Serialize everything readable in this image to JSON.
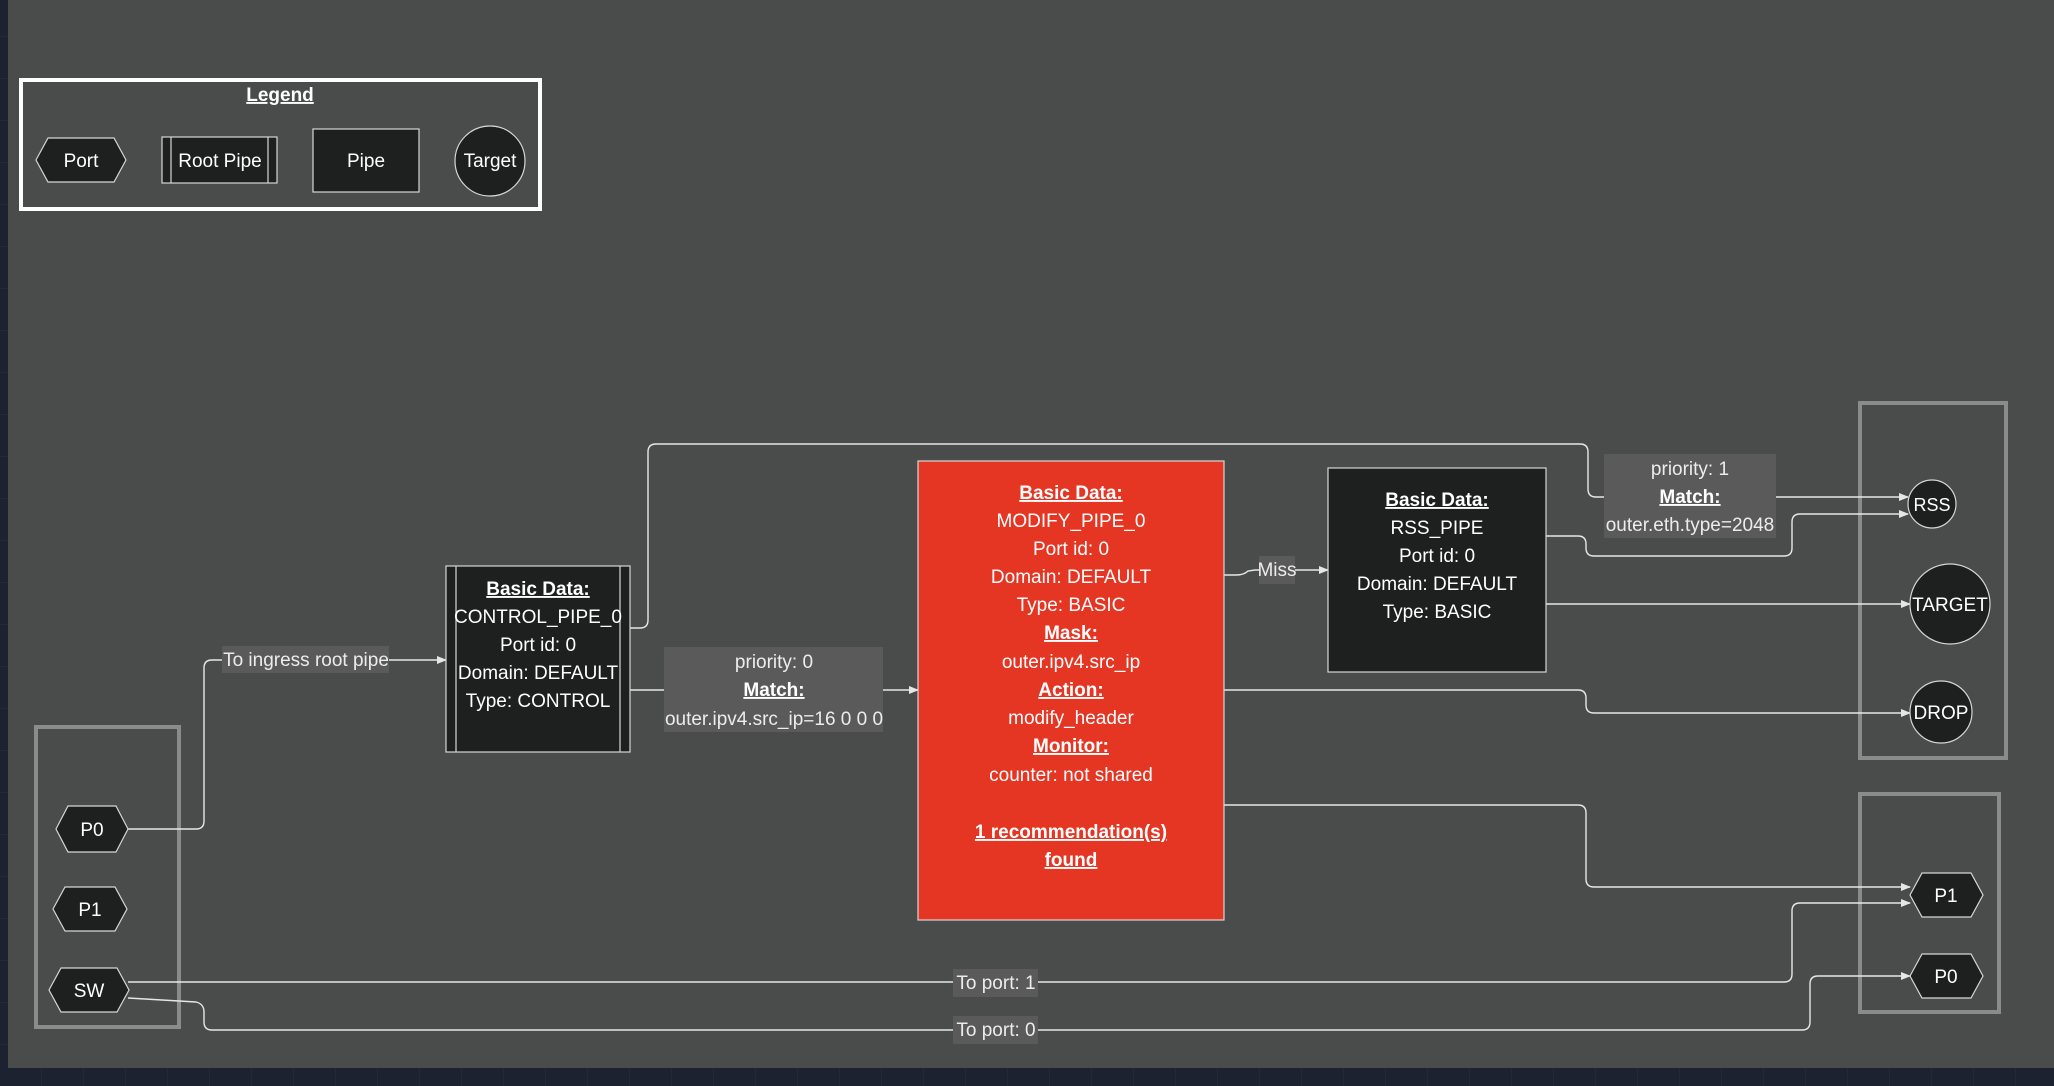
{
  "legend": {
    "title": "Legend",
    "items": {
      "port": "Port",
      "root_pipe": "Root Pipe",
      "pipe": "Pipe",
      "target": "Target"
    }
  },
  "ports_in": {
    "p0": "P0",
    "p1": "P1",
    "sw": "SW"
  },
  "ports_out": {
    "p1": "P1",
    "p0": "P0"
  },
  "targets": {
    "rss": "RSS",
    "target": "TARGET",
    "drop": "DROP"
  },
  "control_pipe": {
    "header": "Basic Data:",
    "name": "CONTROL_PIPE_0",
    "port_id": "Port id: 0",
    "domain": "Domain: DEFAULT",
    "type": "Type: CONTROL"
  },
  "modify_pipe": {
    "header": "Basic Data:",
    "name": "MODIFY_PIPE_0",
    "port_id": "Port id: 0",
    "domain": "Domain: DEFAULT",
    "type": "Type: BASIC",
    "mask_header": "Mask:",
    "mask": "outer.ipv4.src_ip",
    "action_header": "Action:",
    "action": "modify_header",
    "monitor_header": "Monitor:",
    "monitor": "counter: not shared",
    "recommendation_line1": "1 recommendation(s)",
    "recommendation_line2": "found",
    "color": "#e53523"
  },
  "rss_pipe": {
    "header": "Basic Data:",
    "name": "RSS_PIPE",
    "port_id": "Port id: 0",
    "domain": "Domain: DEFAULT",
    "type": "Type: BASIC"
  },
  "edges": {
    "to_ingress": "To ingress root pipe",
    "ctrl_priority": "priority: 0",
    "ctrl_match_header": "Match:",
    "ctrl_match": "outer.ipv4.src_ip=16 0 0 0",
    "miss": "Miss",
    "rss_priority": "priority: 1",
    "rss_match_header": "Match:",
    "rss_match": "outer.eth.type=2048",
    "to_port_1": "To port: 1",
    "to_port_0": "To port: 0"
  }
}
